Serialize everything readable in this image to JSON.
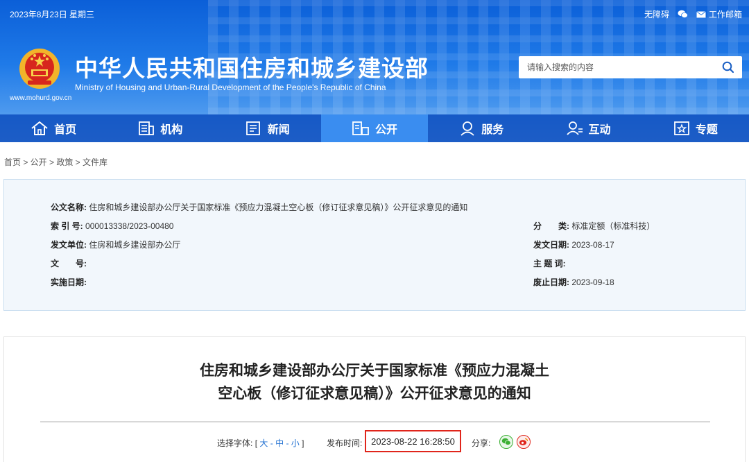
{
  "header": {
    "date": "2023年8月23日 星期三",
    "accessibility_link": "无障碍",
    "mail_link": "工作邮箱",
    "site_title_cn": "中华人民共和国住房和城乡建设部",
    "site_title_en": "Ministry of Housing and Urban-Rural Development of the People's Republic of China",
    "site_url": "www.mohurd.gov.cn",
    "search_placeholder": "请输入搜索的内容"
  },
  "nav": {
    "items": [
      {
        "label": "首页",
        "icon": "home-icon"
      },
      {
        "label": "机构",
        "icon": "organization-icon"
      },
      {
        "label": "新闻",
        "icon": "news-icon"
      },
      {
        "label": "公开",
        "icon": "disclosure-icon",
        "active": true
      },
      {
        "label": "服务",
        "icon": "service-icon"
      },
      {
        "label": "互动",
        "icon": "interaction-icon"
      },
      {
        "label": "专题",
        "icon": "topic-icon"
      }
    ]
  },
  "breadcrumb": "首页 > 公开 > 政策 > 文件库",
  "meta": {
    "doc_name_label": "公文名称:",
    "doc_name": "住房和城乡建设部办公厅关于国家标准《预应力混凝土空心板（修订征求意见稿）》公开征求意见的通知",
    "index_label": "索 引 号:",
    "index_value": "000013338/2023-00480",
    "category_label": "分　　类:",
    "category_value": "标准定额（标准科技）",
    "issuer_label": "发文单位:",
    "issuer_value": "住房和城乡建设部办公厅",
    "issue_date_label": "发文日期:",
    "issue_date_value": "2023-08-17",
    "doc_no_label": "文　　号:",
    "doc_no_value": "",
    "subject_label": "主 题 词:",
    "subject_value": "",
    "effective_label": "实施日期:",
    "effective_value": "",
    "expiry_label": "废止日期:",
    "expiry_value": "2023-09-18"
  },
  "article": {
    "title_line1": "住房和城乡建设部办公厅关于国家标准《预应力混凝土",
    "title_line2": "空心板（修订征求意见稿）》公开征求意见的通知",
    "font_size_label": "选择字体:",
    "font_open": "[",
    "font_large": "大",
    "font_medium": "中",
    "font_small": "小",
    "font_sep": "-",
    "font_close": "]",
    "publish_label": "发布时间:",
    "publish_time": "2023-08-22 16:28:50",
    "share_label": "分享:"
  },
  "colors": {
    "header_blue": "#1f7ae8",
    "nav_active": "#3a8df0",
    "highlight_red": "#e0251b"
  }
}
